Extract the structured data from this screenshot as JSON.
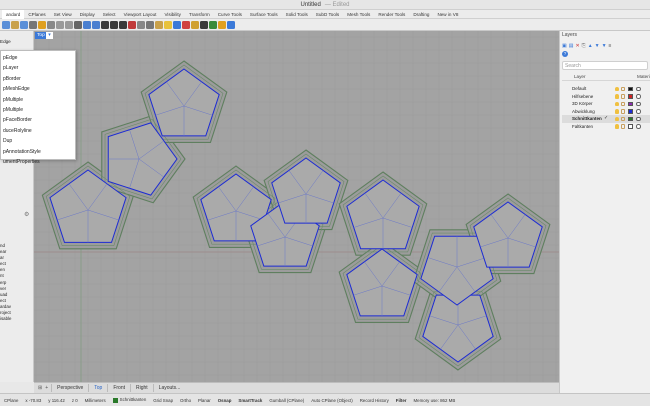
{
  "window": {
    "title": "Untitled",
    "subtitle": "— Edited"
  },
  "toolbar_tabs": [
    "andard",
    "CPlanes",
    "Set View",
    "Display",
    "Select",
    "Viewport Layout",
    "Visibility",
    "Transform",
    "Curve Tools",
    "Surface Tools",
    "Solid Tools",
    "SubD Tools",
    "Mesh Tools",
    "Render Tools",
    "Drafting",
    "New in V8"
  ],
  "command": {
    "title": "Edge",
    "input": "pEdge",
    "history": [
      "nd",
      "ear",
      "ar",
      "ect",
      "en",
      "nt",
      "erp",
      "ver",
      "uad",
      "ect",
      "ardav",
      "roject",
      "",
      "isable"
    ]
  },
  "autocomplete": {
    "items": [
      "pEdge",
      "pLayer",
      "pBorder",
      "pMeshEdge",
      "pMultiple",
      "pMultiple",
      "pFaceBorder",
      "duceRolyline",
      "Dup",
      "pAnnotationStyle",
      "umentProperties"
    ]
  },
  "viewport": {
    "label": "Top"
  },
  "view_tabs": [
    "Perspective",
    "Top",
    "Front",
    "Right",
    "Layouts..."
  ],
  "layers_panel": {
    "title": "Layers",
    "search_placeholder": "Search",
    "col_layer": "Layer",
    "col_material": "Materi",
    "check": "✓",
    "layers": [
      {
        "name": "Default",
        "color": "#111111",
        "bold": false,
        "current": false
      },
      {
        "name": "Hilfsebene",
        "color": "#cc2222",
        "bold": false,
        "current": false
      },
      {
        "name": "3D Körper",
        "color": "#8c2ab0",
        "bold": false,
        "current": false
      },
      {
        "name": "Abwicklung",
        "color": "#1c2bd4",
        "bold": false,
        "current": false
      },
      {
        "name": "Schnittkanten",
        "color": "#2b7a2b",
        "bold": true,
        "current": true
      },
      {
        "name": "Faltkanten",
        "color": "#ffffff",
        "bold": false,
        "current": false
      }
    ]
  },
  "status": {
    "cplane": "CPlane",
    "x": "x -70.83",
    "y": "y 116.42",
    "z": "z 0",
    "units": "Millimeters",
    "layer": "Schnittkanten",
    "items": [
      "Grid Snap",
      "Ortho",
      "Planar",
      "Osnap",
      "SmartTrack",
      "Gumball (CPlane)",
      "Auto CPlane (Object)",
      "Record History",
      "Filter",
      "Memory use: 862 MB"
    ]
  },
  "colors": {
    "accent": "#3b79d8",
    "viewport_bg": "#a3a3a3",
    "edge_blue": "#1c2bd4",
    "cut_outline": "#3f6f3f"
  },
  "icons": [
    "file-icon",
    "open-icon",
    "save-icon",
    "print-icon",
    "import-icon",
    "cut-icon",
    "copy-icon",
    "paste-icon",
    "undo-icon",
    "pan-icon",
    "rotate-icon",
    "zoom-icon",
    "zoom-window-icon",
    "zoom-extents-icon",
    "select-icon",
    "display-icon",
    "grid-icon",
    "lock-icon",
    "bulb-icon",
    "layers-icon",
    "gumball-icon",
    "snap-icon",
    "render-icon",
    "material-icon",
    "sun-icon",
    "help-icon"
  ]
}
